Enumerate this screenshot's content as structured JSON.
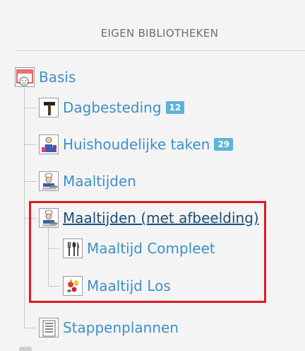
{
  "header": {
    "title": "EIGEN BIBLIOTHEKEN"
  },
  "tree": {
    "root": {
      "label": "Basis",
      "icon": "calendar-face-icon"
    },
    "children": [
      {
        "label": "Dagbesteding",
        "badge": "12",
        "icon": "hammer-icon"
      },
      {
        "label": "Huishoudelijke taken",
        "badge": "29",
        "icon": "cleaning-icon"
      },
      {
        "label": "Maaltijden",
        "icon": "chef-icon"
      },
      {
        "label": "Maaltijden (met afbeelding)",
        "icon": "chef-icon",
        "selected": true,
        "children": [
          {
            "label": "Maaltijd Compleet",
            "icon": "cutlery-icon"
          },
          {
            "label": "Maaltijd Los",
            "icon": "food-items-icon"
          }
        ]
      },
      {
        "label": "Stappenplannen",
        "icon": "list-icon"
      }
    ]
  },
  "colors": {
    "link": "#3e8fc9",
    "active": "#1d4e7a",
    "badge": "#5eb4d6",
    "highlight": "#e01a22"
  }
}
